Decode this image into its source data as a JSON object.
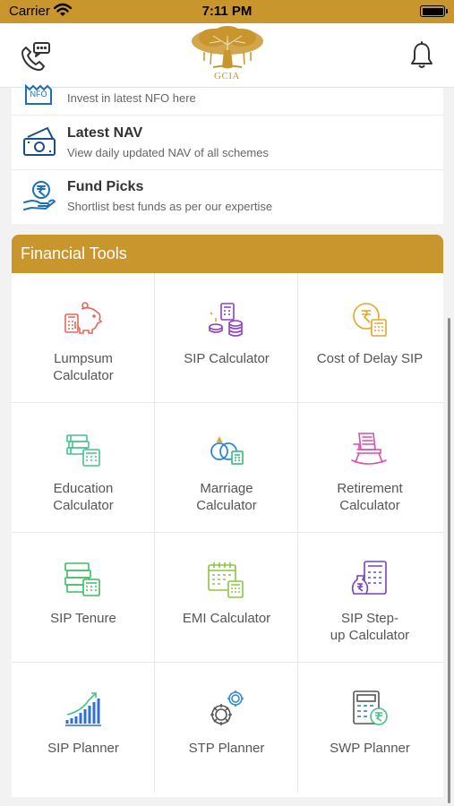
{
  "status": {
    "carrier": "Carrier",
    "time": "7:11 PM"
  },
  "header": {
    "logo_text": "GCIA",
    "left_icon": "phone-chat-icon",
    "right_icon": "bell-icon"
  },
  "menu": [
    {
      "icon": "nfo-badge-icon",
      "title": "",
      "subtitle": "Invest in latest NFO here",
      "nfo_badge": "NFO"
    },
    {
      "icon": "banknotes-icon",
      "title": "Latest NAV",
      "subtitle": "View daily updated NAV of all schemes"
    },
    {
      "icon": "rupee-hand-icon",
      "title": "Fund Picks",
      "subtitle": "Shortlist best funds as per our expertise"
    }
  ],
  "tools": {
    "title": "Financial Tools",
    "items": [
      {
        "l1": "Lumpsum",
        "l2": "Calculator",
        "icon": "piggy-calculator-icon",
        "color": "#e8675a"
      },
      {
        "l1": "SIP Calculator",
        "l2": "",
        "icon": "coins-calculator-icon",
        "color": "#8a3fc7"
      },
      {
        "l1": "Cost of Delay SIP",
        "l2": "",
        "icon": "rupee-coin-calculator-icon",
        "color": "#e3a72a"
      },
      {
        "l1": "Education",
        "l2": "Calculator",
        "icon": "books-calculator-icon",
        "color": "#45c28a"
      },
      {
        "l1": "Marriage",
        "l2": "Calculator",
        "icon": "rings-calculator-icon",
        "color": "#2f86d6"
      },
      {
        "l1": "Retirement",
        "l2": "Calculator",
        "icon": "rocking-chair-icon",
        "color": "#d94fae"
      },
      {
        "l1": "SIP Tenure",
        "l2": "",
        "icon": "stack-calculator-icon",
        "color": "#3fba63"
      },
      {
        "l1": "EMI Calculator",
        "l2": "",
        "icon": "calendar-calculator-icon",
        "color": "#8cc63f"
      },
      {
        "l1": "SIP Step-",
        "l2": "up Calculator",
        "icon": "rupee-bag-calculator-icon",
        "color": "#7a3fc4"
      },
      {
        "l1": "SIP Planner",
        "l2": "",
        "icon": "rising-bars-icon",
        "color": "#2f6fd6"
      },
      {
        "l1": "STP Planner",
        "l2": "",
        "icon": "gears-icon",
        "color": "#2f86d6"
      },
      {
        "l1": "SWP Planner",
        "l2": "",
        "icon": "calculator-rupee-icon",
        "color": "#2f6fd6"
      }
    ]
  }
}
